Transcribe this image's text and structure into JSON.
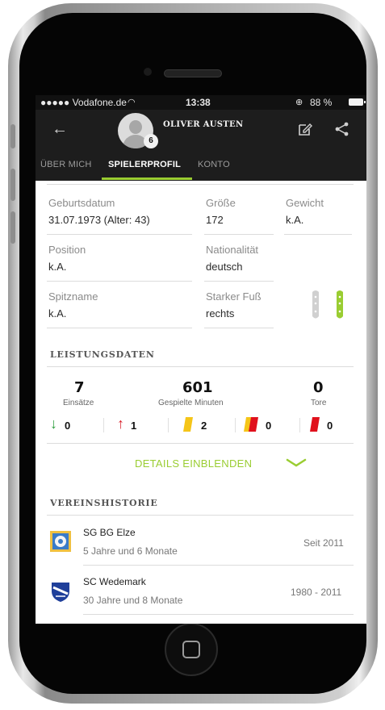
{
  "status_bar": {
    "carrier": "●●●●● Vodafone.de",
    "time": "13:38",
    "battery": "88 %"
  },
  "header": {
    "player_name": "OLIVER AUSTEN",
    "jersey_number": "6"
  },
  "tabs": [
    {
      "label": "ÜBER MICH",
      "active": false
    },
    {
      "label": "SPIELERPROFIL",
      "active": true
    },
    {
      "label": "KONTO",
      "active": false
    }
  ],
  "profile": {
    "birthdate_label": "Geburtsdatum",
    "birthdate_value": "31.07.1973 (Alter: 43)",
    "height_label": "Größe",
    "height_value": "172",
    "weight_label": "Gewicht",
    "weight_value": "k.A.",
    "position_label": "Position",
    "position_value": "k.A.",
    "nationality_label": "Nationalität",
    "nationality_value": "deutsch",
    "nickname_label": "Spitzname",
    "nickname_value": "k.A.",
    "foot_label": "Starker Fuß",
    "foot_value": "rechts"
  },
  "performance": {
    "title": "LEISTUNGSDATEN",
    "appearances_value": "7",
    "appearances_label": "Einsätze",
    "minutes_value": "601",
    "minutes_label": "Gespielte Minuten",
    "goals_value": "0",
    "goals_label": "Tore",
    "subbed_in": "0",
    "subbed_out": "1",
    "yellow_cards": "2",
    "yellow_red_cards": "0",
    "red_cards": "0"
  },
  "details_label": "DETAILS EINBLENDEN",
  "club_history": {
    "title": "VEREINSHISTORIE",
    "clubs": [
      {
        "name": "SG BG Elze",
        "duration": "5 Jahre und 6 Monate",
        "period": "Seit 2011"
      },
      {
        "name": "SC Wedemark",
        "duration": "30 Jahre und 8 Monate",
        "period": "1980 - 2011"
      }
    ]
  },
  "colors": {
    "accent_green": "#9acd32",
    "appbar": "#1d1d1d",
    "arrow_in": "#2e9e3e",
    "arrow_out": "#d9232d",
    "yellow_card": "#f5c518",
    "red_card": "#e0101c"
  }
}
